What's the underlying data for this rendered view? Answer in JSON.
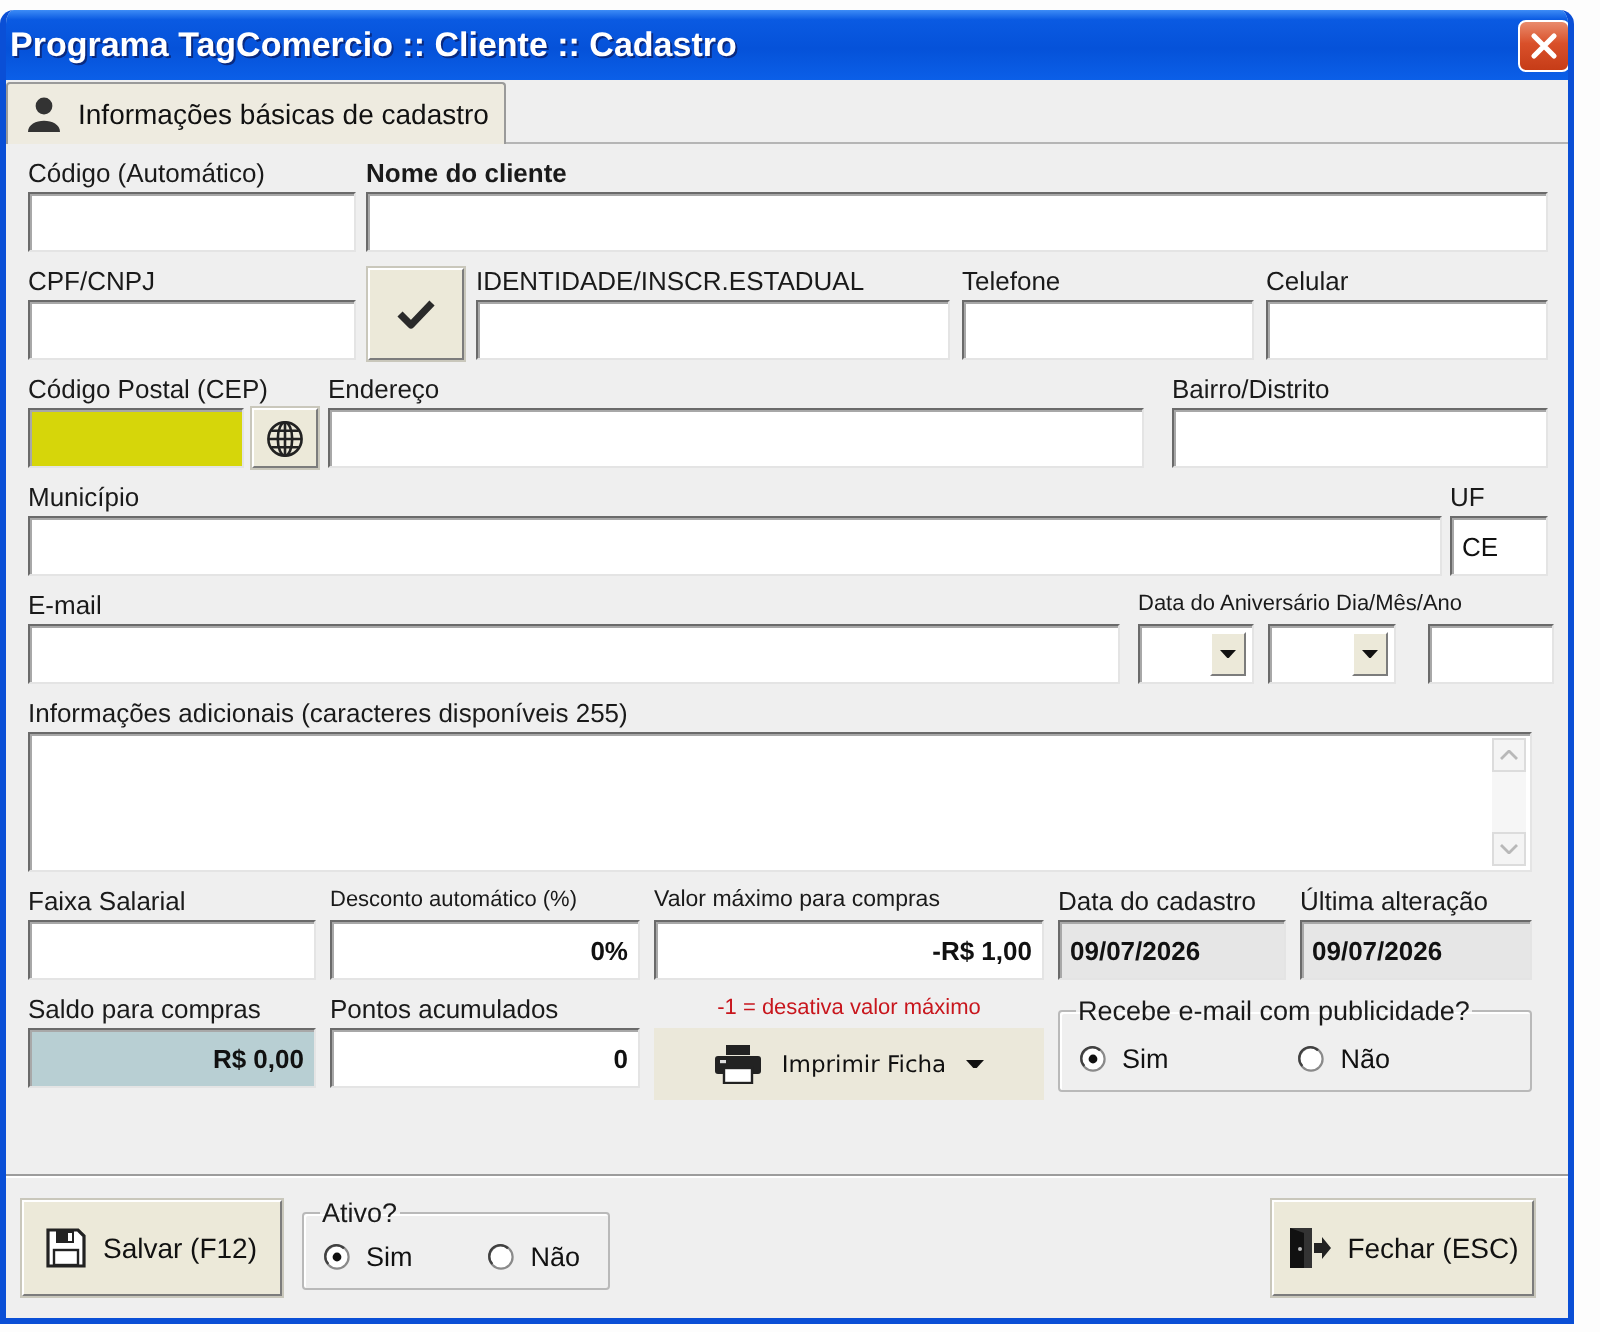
{
  "window": {
    "title": "Programa TagComercio :: Cliente :: Cadastro"
  },
  "tabs": [
    {
      "label": "Informações básicas de cadastro",
      "selected": true
    }
  ],
  "fields": {
    "code": {
      "label": "Código (Automático)"
    },
    "name": {
      "label": "Nome do cliente",
      "required": true
    },
    "cpf": {
      "label": "CPF/CNPJ"
    },
    "identity": {
      "label": "IDENTIDADE/INSCR.ESTADUAL"
    },
    "phone": {
      "label": "Telefone"
    },
    "mobile": {
      "label": "Celular"
    },
    "postal_code": {
      "label": "Código Postal (CEP)",
      "focused": true
    },
    "address": {
      "label": "Endereço"
    },
    "district": {
      "label": "Bairro/Distrito"
    },
    "city": {
      "label": "Município"
    },
    "state": {
      "label": "UF",
      "value": "CE"
    },
    "email": {
      "label": "E-mail"
    },
    "birthday": {
      "label": "Data do Aniversário Dia/Mês/Ano"
    },
    "notes": {
      "label": "Informações adicionais (caracteres disponíveis 255)"
    },
    "salary_range": {
      "label": "Faixa Salarial"
    },
    "discount": {
      "label": "Desconto automático (%)",
      "value": "0%"
    },
    "max_purchase": {
      "label": "Valor máximo para compras",
      "value": "-R$ 1,00"
    },
    "registered": {
      "label": "Data do cadastro",
      "value": "09/07/2026",
      "readonly": true
    },
    "last_change": {
      "label": "Última alteração",
      "value": "09/07/2026",
      "readonly": true
    },
    "balance": {
      "label": "Saldo para compras",
      "value": "R$ 0,00",
      "readonly": true
    },
    "points": {
      "label": "Pontos acumulados",
      "value": "0"
    }
  },
  "max_purchase_hint": "-1 = desativa valor máximo",
  "print_button": {
    "label": "Imprimir Ficha"
  },
  "email_optin": {
    "label": "Recebe e-mail com publicidade?",
    "options": [
      {
        "label": "Sim",
        "selected": true
      },
      {
        "label": "Não",
        "selected": false
      }
    ]
  },
  "footer": {
    "save_button": {
      "label": "Salvar (F12)"
    },
    "active": {
      "label": "Ativo?",
      "options": [
        {
          "label": "Sim",
          "selected": true
        },
        {
          "label": "Não",
          "selected": false
        }
      ]
    },
    "close_button": {
      "label": "Fechar (ESC)"
    }
  }
}
